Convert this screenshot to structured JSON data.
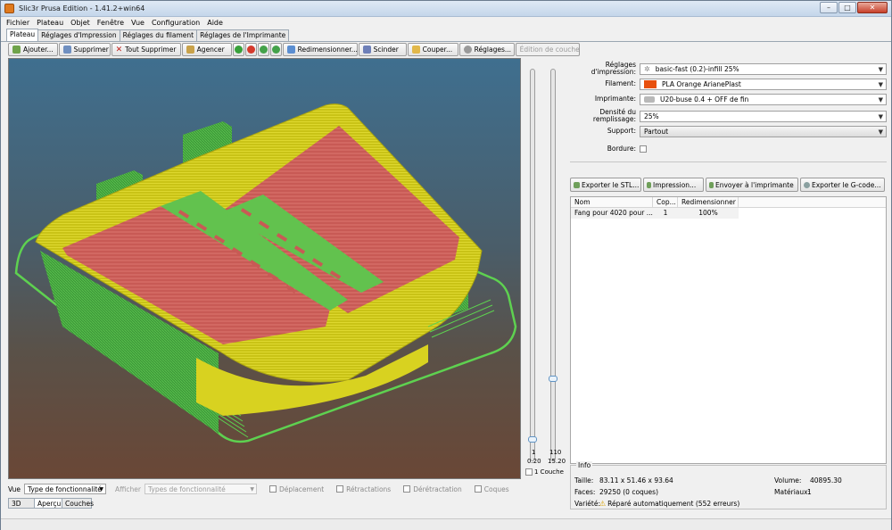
{
  "window": {
    "title": "Slic3r Prusa Edition - 1.41.2+win64",
    "minimize": "–",
    "maximize": "□",
    "close": "✕"
  },
  "menu": [
    "Fichier",
    "Plateau",
    "Objet",
    "Fenêtre",
    "Vue",
    "Configuration",
    "Aide"
  ],
  "tabs": [
    "Plateau",
    "Réglages d'Impression",
    "Réglages du filament",
    "Réglages de l'Imprimante"
  ],
  "toolbar": {
    "add": "Ajouter...",
    "delete": "Supprimer",
    "delete_all": "Tout Supprimer",
    "arrange": "Agencer",
    "scale": "Redimensionner...",
    "split": "Scinder",
    "cut": "Couper...",
    "settings": "Réglages...",
    "layer_edit": "Édition de couche"
  },
  "slider": {
    "top_layer": "110",
    "top_height": "15.20",
    "bottom_layer": "1",
    "bottom_height": "0.20",
    "one_layer": "1 Couche"
  },
  "settings": {
    "print_label": "Réglages d'impression:",
    "print_value": "basic-fast (0.2)-infill 25%",
    "filament_label": "Filament:",
    "filament_value": "PLA Orange ArianePlast",
    "filament_color": "#e8500e",
    "printer_label": "Imprimante:",
    "printer_value": "U20-buse 0.4 + OFF de fin",
    "infill_label": "Densité du remplissage:",
    "infill_value": "25%",
    "support_label": "Support:",
    "support_value": "Partout",
    "brim_label": "Bordure:"
  },
  "actions": {
    "export_stl": "Exporter le STL...",
    "print": "Impression...",
    "send": "Envoyer à l'imprimante",
    "export_gcode": "Exporter le G-code..."
  },
  "list": {
    "headers": [
      "Nom",
      "Cop...",
      "Redimensionner"
    ],
    "rows": [
      [
        "Fang pour 4020 pour ...",
        "1",
        "100%"
      ]
    ]
  },
  "info": {
    "title": "Info",
    "size_label": "Taille:",
    "size_value": "83.11 x 51.46 x 93.64",
    "volume_label": "Volume:",
    "volume_value": "40895.30",
    "faces_label": "Faces:",
    "faces_value": "29250 (0 coques)",
    "materials_label": "Matériaux:",
    "materials_value": "1",
    "manifold_label": "Variété:",
    "manifold_value": "Réparé automatiquement (552 erreurs)"
  },
  "bottom": {
    "view_label": "Vue",
    "view_value": "Type de fonctionnalité",
    "show_label": "Afficher",
    "show_value": "Types de fonctionnalité",
    "travel": "Déplacement",
    "retractions": "Rétractations",
    "unretractions": "Dérétractation",
    "shells": "Coques"
  },
  "bottom_tabs": [
    "3D",
    "Aperçu",
    "Couches"
  ]
}
